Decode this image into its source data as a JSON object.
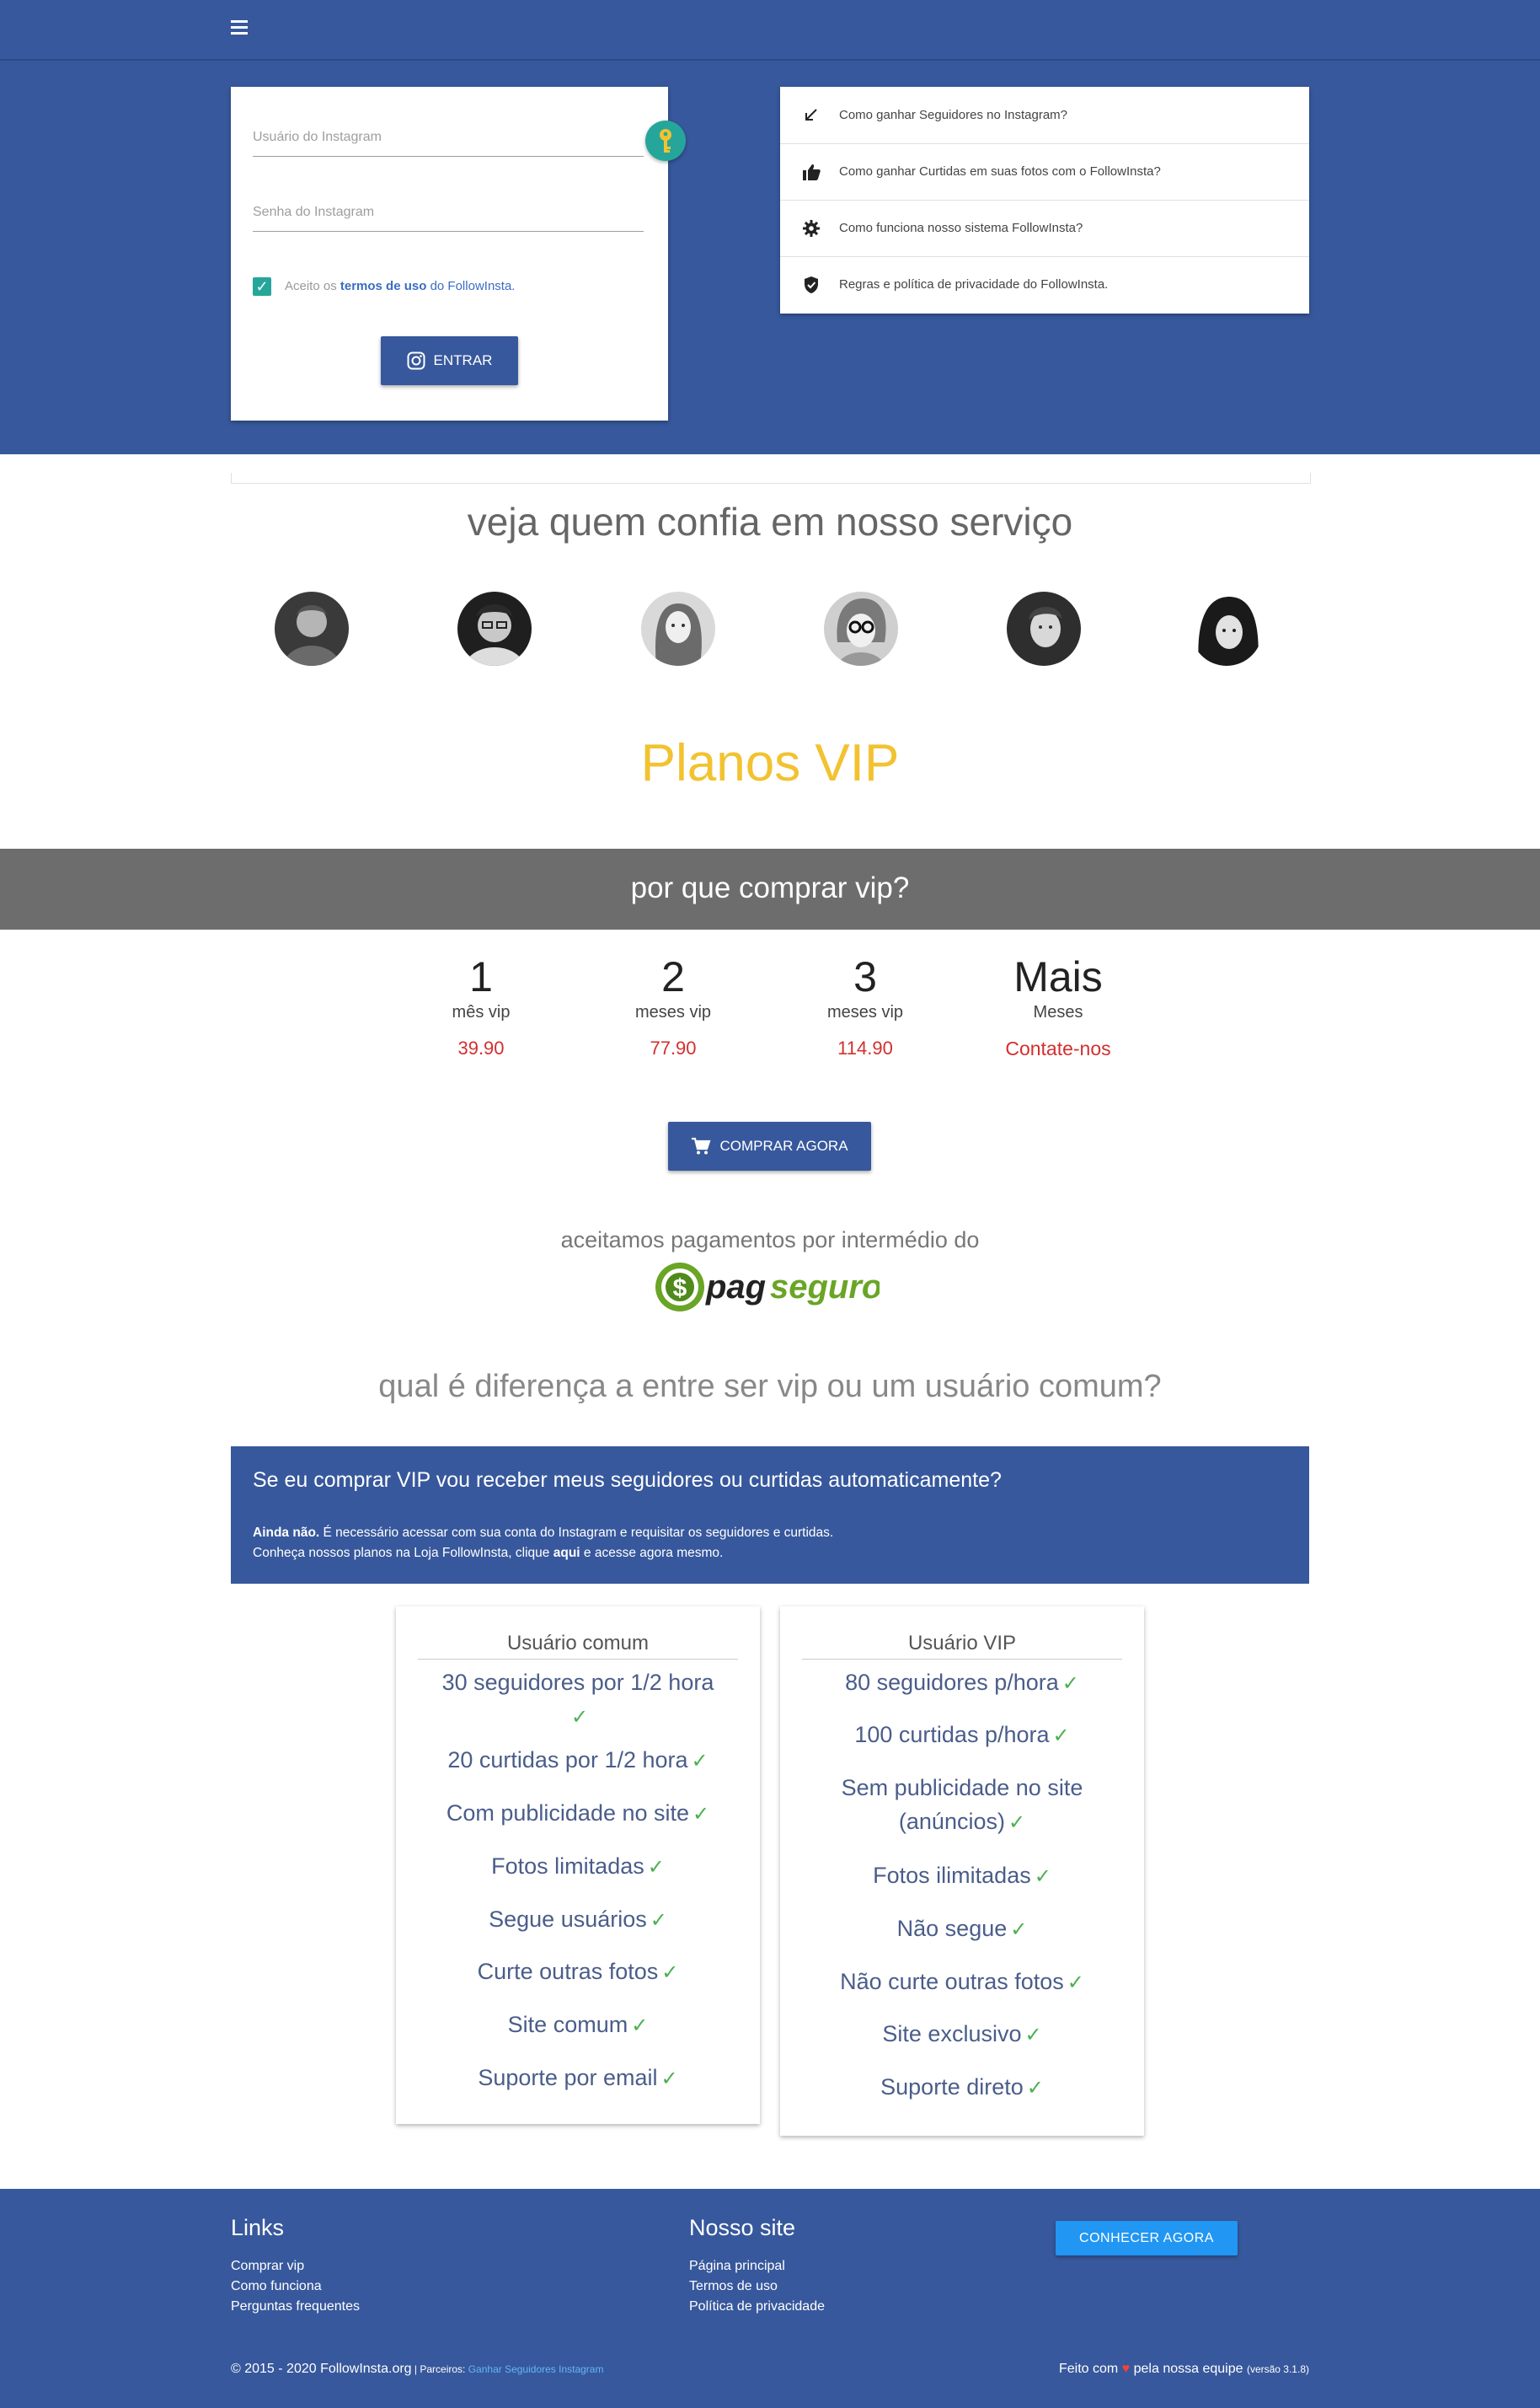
{
  "header": {
    "menu_icon": "menu-icon"
  },
  "login": {
    "username_placeholder": "Usuário do Instagram",
    "password_placeholder": "Senha do Instagram",
    "terms_prefix": "Aceito os ",
    "terms_link": "termos de uso",
    "terms_suffix": " do FollowInsta.",
    "enter_label": "ENTRAR",
    "checkbox_checked": true
  },
  "help": {
    "items": [
      {
        "icon": "arrow-down-left-icon",
        "label": "Como ganhar Seguidores no Instagram?"
      },
      {
        "icon": "thumbs-up-icon",
        "label": "Como ganhar Curtidas em suas fotos com o FollowInsta?"
      },
      {
        "icon": "gear-icon",
        "label": "Como funciona nosso sistema FollowInsta?"
      },
      {
        "icon": "shield-check-icon",
        "label": "Regras e política de privacidade do FollowInsta."
      }
    ]
  },
  "trust": {
    "title": "veja quem confia em nosso serviço"
  },
  "vip": {
    "title": "Planos VIP"
  },
  "why": {
    "title": "por que comprar vip?",
    "plans": [
      {
        "num": "1",
        "unit": "mês vip",
        "price": "39.90"
      },
      {
        "num": "2",
        "unit": "meses vip",
        "price": "77.90"
      },
      {
        "num": "3",
        "unit": "meses vip",
        "price": "114.90"
      },
      {
        "num": "Mais",
        "unit": "Meses",
        "price": "Contate-nos"
      }
    ],
    "buy_label": "COMPRAR AGORA"
  },
  "payment": {
    "text": "aceitamos pagamentos por intermédio do",
    "logo_text": "pagseguro"
  },
  "difference": {
    "title": "qual é diferença a entre ser vip ou um usuário comum?"
  },
  "faq": {
    "question": "Se eu comprar VIP vou receber meus seguidores ou curtidas automaticamente?",
    "answer_bold": "Ainda não.",
    "answer_rest": " É necessário acessar com sua conta do Instagram e requisitar os seguidores e curtidas.",
    "answer_line2_prefix": "Conheça nossos planos na Loja FollowInsta, clique ",
    "answer_line2_bold": "aqui",
    "answer_line2_suffix": " e acesse agora mesmo."
  },
  "compare": {
    "common": {
      "title": "Usuário comum",
      "items": [
        "30 seguidores por 1/2 hora",
        "20 curtidas por 1/2 hora",
        "Com publicidade no site",
        "Fotos limitadas",
        "Segue usuários",
        "Curte outras fotos",
        "Site comum",
        "Suporte por email"
      ]
    },
    "vip": {
      "title": "Usuário VIP",
      "items": [
        "80 seguidores p/hora",
        "100 curtidas p/hora",
        "Sem publicidade no site (anúncios)",
        "Fotos ilimitadas",
        "Não segue",
        "Não curte outras fotos",
        "Site exclusivo",
        "Suporte direto"
      ]
    }
  },
  "footer": {
    "links_title": "Links",
    "links": [
      "Comprar vip",
      "Como funciona",
      "Perguntas frequentes"
    ],
    "site_title": "Nosso site",
    "site_links": [
      "Página principal",
      "Termos de uso",
      "Política de privacidade"
    ],
    "cta_label": "CONHECER AGORA",
    "copyright": "© 2015 - 2020 FollowInsta.org",
    "partners_label": " | Parceiros: ",
    "partner_link": "Ganhar Seguidores Instagram",
    "made_prefix": "Feito com ",
    "made_suffix": " pela nossa equipe ",
    "version": "(versão 3.1.8)"
  },
  "colors": {
    "primary": "#37589c",
    "teal": "#26a69a",
    "vip_yellow": "#f2c230",
    "price_red": "#d32f2f",
    "check_green": "#4caf50",
    "cta_blue": "#2196f3"
  }
}
